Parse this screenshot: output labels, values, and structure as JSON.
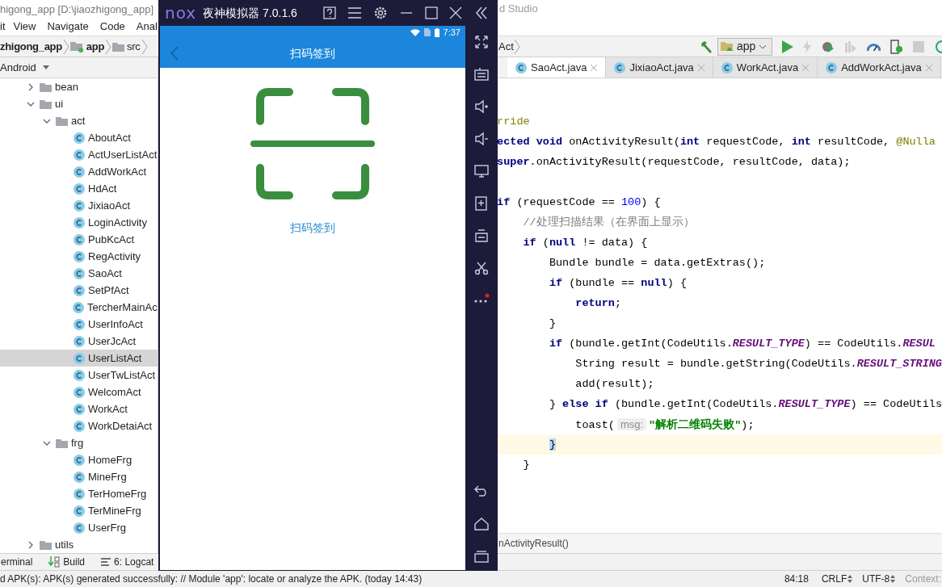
{
  "studio": {
    "title": "higong_app [D:\\jiaozhigong_app]",
    "title_end": "d Studio",
    "menu": [
      "it",
      "View",
      "Navigate",
      "Code",
      "Anal"
    ],
    "nav": [
      {
        "label": "zhigong_app",
        "kind": "module"
      },
      {
        "label": "app",
        "kind": "app_folder"
      },
      {
        "label": "src",
        "kind": "folder"
      }
    ],
    "nav_right": "Act",
    "run_config": "app",
    "view_selector": "Android",
    "tabs": [
      {
        "label": "SaoAct.java",
        "selected": true
      },
      {
        "label": "JixiaoAct.java",
        "selected": false
      },
      {
        "label": "WorkAct.java",
        "selected": false
      },
      {
        "label": "AddWorkAct.java",
        "selected": false
      }
    ],
    "tree": [
      {
        "label": "bean",
        "kind": "folder",
        "expanded": false,
        "selected": false
      },
      {
        "label": "ui",
        "kind": "folder",
        "expanded": true,
        "selected": false,
        "children": [
          {
            "label": "act",
            "kind": "folder",
            "expanded": true,
            "selected": false,
            "children": [
              {
                "label": "AboutAct",
                "kind": "class",
                "selected": false
              },
              {
                "label": "ActUserListAct",
                "kind": "class",
                "selected": false
              },
              {
                "label": "AddWorkAct",
                "kind": "class",
                "selected": false
              },
              {
                "label": "HdAct",
                "kind": "class",
                "selected": false
              },
              {
                "label": "JixiaoAct",
                "kind": "class",
                "selected": false
              },
              {
                "label": "LoginActivity",
                "kind": "class",
                "selected": false
              },
              {
                "label": "PubKcAct",
                "kind": "class",
                "selected": false
              },
              {
                "label": "RegActivity",
                "kind": "class",
                "selected": false
              },
              {
                "label": "SaoAct",
                "kind": "class",
                "selected": false
              },
              {
                "label": "SetPfAct",
                "kind": "class",
                "selected": false
              },
              {
                "label": "TercherMainAc",
                "kind": "class",
                "selected": false
              },
              {
                "label": "UserInfoAct",
                "kind": "class",
                "selected": false
              },
              {
                "label": "UserJcAct",
                "kind": "class",
                "selected": false
              },
              {
                "label": "UserListAct",
                "kind": "class",
                "selected": true
              },
              {
                "label": "UserTwListAct",
                "kind": "class",
                "selected": false
              },
              {
                "label": "WelcomAct",
                "kind": "class",
                "selected": false
              },
              {
                "label": "WorkAct",
                "kind": "class",
                "selected": false
              },
              {
                "label": "WorkDetaiAct",
                "kind": "class",
                "selected": false
              }
            ]
          },
          {
            "label": "frg",
            "kind": "folder",
            "expanded": true,
            "selected": false,
            "children": [
              {
                "label": "HomeFrg",
                "kind": "class",
                "selected": false
              },
              {
                "label": "MineFrg",
                "kind": "class",
                "selected": false
              },
              {
                "label": "TerHomeFrg",
                "kind": "class",
                "selected": false
              },
              {
                "label": "TerMineFrg",
                "kind": "class",
                "selected": false
              },
              {
                "label": "UserFrg",
                "kind": "class",
                "selected": false
              }
            ]
          }
        ]
      },
      {
        "label": "utils",
        "kind": "folder",
        "expanded": false,
        "selected": false
      }
    ],
    "code": [
      {
        "kind": "code",
        "current": false,
        "tokens": [
          {
            "text": "rride",
            "kind": "annotation"
          }
        ]
      },
      {
        "kind": "code",
        "current": false,
        "tokens": [
          {
            "text": "ected void",
            "kind": "keyword"
          },
          {
            "text": " onActivityResult(",
            "kind": "plain"
          },
          {
            "text": "int",
            "kind": "keyword"
          },
          {
            "text": " requestCode, ",
            "kind": "plain"
          },
          {
            "text": "int",
            "kind": "keyword"
          },
          {
            "text": " resultCode, ",
            "kind": "plain"
          },
          {
            "text": "@Nulla",
            "kind": "annotation"
          }
        ]
      },
      {
        "kind": "code",
        "current": false,
        "tokens": [
          {
            "text": "super",
            "kind": "keyword"
          },
          {
            "text": ".onActivityResult(requestCode, resultCode, data);",
            "kind": "plain"
          }
        ]
      },
      {
        "kind": "blank",
        "current": false
      },
      {
        "kind": "code",
        "current": false,
        "tokens": [
          {
            "text": "if",
            "kind": "keyword"
          },
          {
            "text": " (requestCode == ",
            "kind": "plain"
          },
          {
            "text": "100",
            "kind": "number"
          },
          {
            "text": ") {",
            "kind": "plain"
          }
        ]
      },
      {
        "kind": "code",
        "current": false,
        "tokens": [
          {
            "text": "    //处理扫描结果（在界面上显示）",
            "kind": "comment"
          }
        ]
      },
      {
        "kind": "code",
        "current": false,
        "tokens": [
          {
            "text": "    if",
            "kind": "keyword"
          },
          {
            "text": " (",
            "kind": "plain"
          },
          {
            "text": "null",
            "kind": "keyword"
          },
          {
            "text": " != data) {",
            "kind": "plain"
          }
        ]
      },
      {
        "kind": "code",
        "current": false,
        "tokens": [
          {
            "text": "        Bundle bundle = data.getExtras();",
            "kind": "plain"
          }
        ]
      },
      {
        "kind": "code",
        "current": false,
        "tokens": [
          {
            "text": "        if",
            "kind": "keyword"
          },
          {
            "text": " (bundle == ",
            "kind": "plain"
          },
          {
            "text": "null",
            "kind": "keyword"
          },
          {
            "text": ") {",
            "kind": "plain"
          }
        ]
      },
      {
        "kind": "code",
        "current": false,
        "tokens": [
          {
            "text": "            return",
            "kind": "keyword"
          },
          {
            "text": ";",
            "kind": "plain"
          }
        ]
      },
      {
        "kind": "code",
        "current": false,
        "tokens": [
          {
            "text": "        }",
            "kind": "plain"
          }
        ]
      },
      {
        "kind": "code",
        "current": false,
        "tokens": [
          {
            "text": "        if",
            "kind": "keyword"
          },
          {
            "text": " (bundle.getInt(CodeUtils.",
            "kind": "plain"
          },
          {
            "text": "RESULT_TYPE",
            "kind": "field"
          },
          {
            "text": ") == CodeUtils.",
            "kind": "plain"
          },
          {
            "text": "RESUL",
            "kind": "field"
          }
        ]
      },
      {
        "kind": "code",
        "current": false,
        "tokens": [
          {
            "text": "            String result = bundle.getString(CodeUtils.",
            "kind": "plain"
          },
          {
            "text": "RESULT_STRING",
            "kind": "field"
          }
        ]
      },
      {
        "kind": "code",
        "current": false,
        "tokens": [
          {
            "text": "            add(result);",
            "kind": "plain"
          }
        ]
      },
      {
        "kind": "code",
        "current": false,
        "tokens": [
          {
            "text": "        } ",
            "kind": "plain"
          },
          {
            "text": "else if",
            "kind": "keyword"
          },
          {
            "text": " (bundle.getInt(CodeUtils.",
            "kind": "plain"
          },
          {
            "text": "RESULT_TYPE",
            "kind": "field"
          },
          {
            "text": ") == CodeUtils",
            "kind": "plain"
          }
        ]
      },
      {
        "kind": "code",
        "current": false,
        "tokens": [
          {
            "text": "            toast(",
            "kind": "plain"
          },
          {
            "text": "msg:",
            "kind": "hint"
          },
          {
            "text": "\"解析二维码失败\"",
            "kind": "string"
          },
          {
            "text": ");",
            "kind": "plain"
          }
        ]
      },
      {
        "kind": "code",
        "current": true,
        "tokens": [
          {
            "text": "}",
            "kind": "brace_match"
          }
        ]
      },
      {
        "kind": "code",
        "current": false,
        "tokens": [
          {
            "text": "    }",
            "kind": "plain"
          }
        ]
      }
    ],
    "code_breadcrumb": "nActivityResult()",
    "tool_windows": [
      {
        "label": "erminal",
        "kind": "terminal"
      },
      {
        "label": "Build",
        "kind": "build"
      },
      {
        "label": "6: Logcat",
        "kind": "logcat"
      }
    ],
    "status": {
      "message": "d APK(s): APK(s) generated successfully: // Module 'app': locate or analyze the APK. (today 14:43)",
      "position": "84:18",
      "line_separator": "CRLF",
      "encoding": "UTF-8",
      "context": "Context:"
    }
  },
  "emulator": {
    "logo": "nox",
    "title": "夜神模拟器 7.0.1.6",
    "phone": {
      "time": "7:37",
      "app_title": "扫码签到",
      "scan_label": "扫码签到"
    }
  }
}
